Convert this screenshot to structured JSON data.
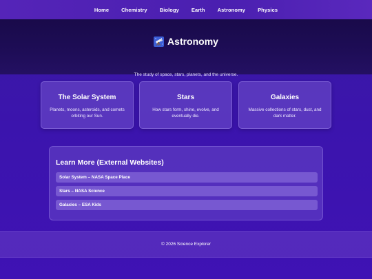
{
  "nav": {
    "items": [
      {
        "label": "Home"
      },
      {
        "label": "Chemistry"
      },
      {
        "label": "Biology"
      },
      {
        "label": "Earth"
      },
      {
        "label": "Astronomy"
      },
      {
        "label": "Physics"
      }
    ]
  },
  "hero": {
    "icon": "telescope-icon",
    "title": "Astronomy",
    "subtitle": "The study of space, stars, planets, and the universe."
  },
  "cards": [
    {
      "title": "The Solar System",
      "description": "Planets, moons, asteroids, and comets orbiting our Sun."
    },
    {
      "title": "Stars",
      "description": "How stars form, shine, evolve, and eventually die."
    },
    {
      "title": "Galaxies",
      "description": "Massive collections of stars, dust, and dark matter."
    }
  ],
  "learn_more": {
    "title": "Learn More (External Websites)",
    "links": [
      {
        "label": "Solar System – NASA Space Place"
      },
      {
        "label": "Stars – NASA Science"
      },
      {
        "label": "Galaxies – ESA Kids"
      }
    ]
  },
  "footer": {
    "text": "© 2026 Science Explorer"
  },
  "colors": {
    "background": "#3b14ad",
    "hero": "#1e0d57",
    "nav": "#4f22b4"
  }
}
